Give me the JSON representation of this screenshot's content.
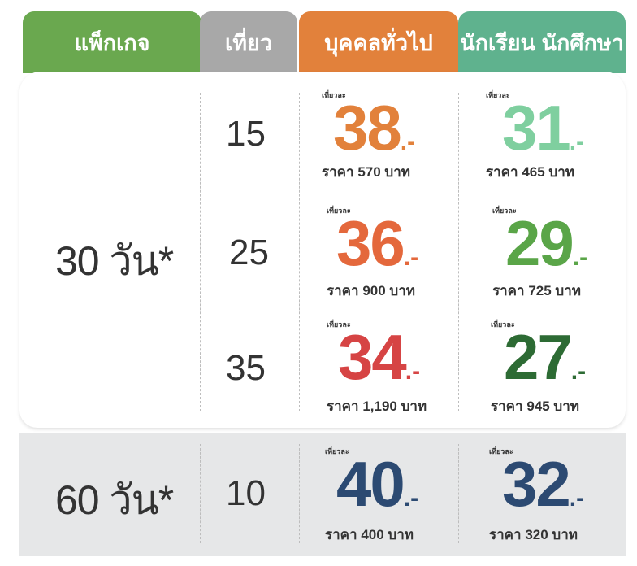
{
  "header": {
    "package": "แพ็กเกจ",
    "trips": "เที่ยว",
    "general": "บุคคลทั่วไป",
    "student": "นักเรียน นักศึกษา"
  },
  "colors": {
    "package_header": "#6aa84f",
    "trips_header": "#a8a8a8",
    "general_header": "#e2813b",
    "student_header": "#5fb28e"
  },
  "per_trip_label": "เที่ยวละ",
  "packages": [
    {
      "label": "30 วัน*",
      "rows": [
        {
          "trips": "15",
          "general": {
            "value": "38",
            "suffix": ".-",
            "price": "ราคา 570 บาท",
            "color": "#e2813b"
          },
          "student": {
            "value": "31",
            "suffix": ".-",
            "price": "ราคา 465 บาท",
            "color": "#7fcf9f"
          }
        },
        {
          "trips": "25",
          "general": {
            "value": "36",
            "suffix": ".-",
            "price": "ราคา 900 บาท",
            "color": "#e4683c"
          },
          "student": {
            "value": "29",
            "suffix": ".-",
            "price": "ราคา 725 บาท",
            "color": "#5aa548"
          }
        },
        {
          "trips": "35",
          "general": {
            "value": "34",
            "suffix": ".-",
            "price": "ราคา 1,190 บาท",
            "color": "#d64444"
          },
          "student": {
            "value": "27",
            "suffix": ".-",
            "price": "ราคา 945 บาท",
            "color": "#2d6b34"
          }
        }
      ]
    },
    {
      "label": "60 วัน*",
      "rows": [
        {
          "trips": "10",
          "general": {
            "value": "40",
            "suffix": ".-",
            "price": "ราคา 400 บาท",
            "color": "#2c4a72"
          },
          "student": {
            "value": "32",
            "suffix": ".-",
            "price": "ราคา 320 บาท",
            "color": "#2c4a72"
          }
        }
      ]
    }
  ]
}
